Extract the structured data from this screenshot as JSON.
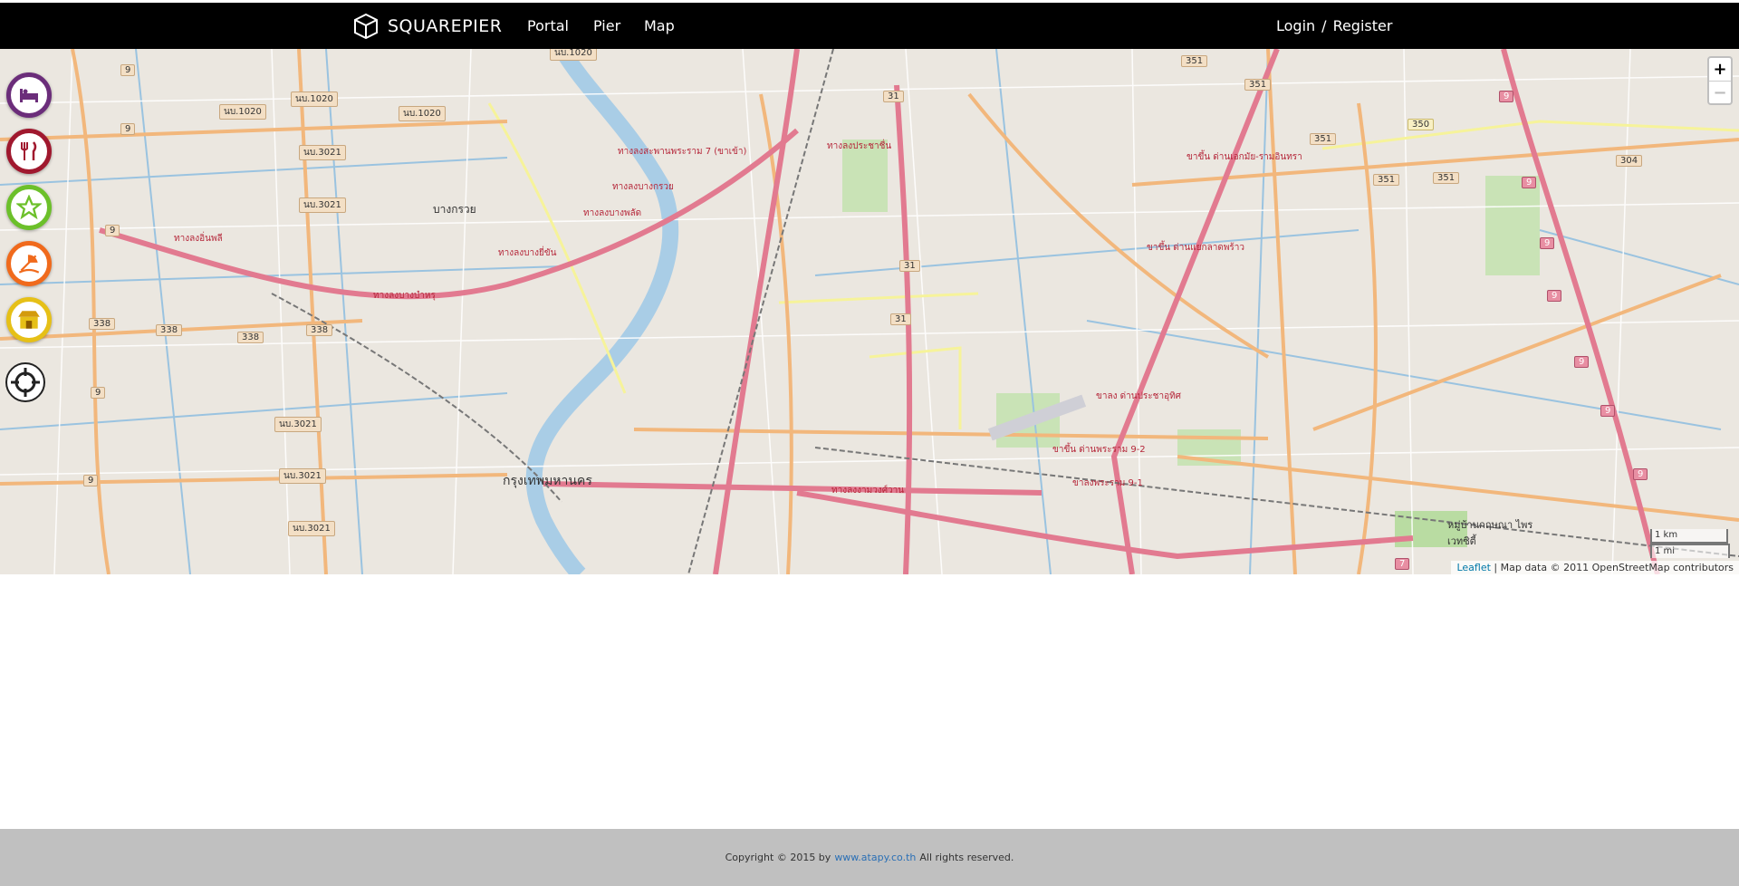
{
  "navbar": {
    "brand": "SQUAREPIER",
    "links": [
      "Portal",
      "Pier",
      "Map"
    ],
    "login": "Login",
    "separator": "/",
    "register": "Register"
  },
  "map": {
    "zoom_in": "+",
    "zoom_out": "−",
    "scale_km": "1 km",
    "scale_mi": "1 mi",
    "attribution": {
      "leaflet": "Leaflet",
      "rest": "| Map data © 2011 OpenStreetMap contributors"
    },
    "categories": [
      {
        "icon": "bed-icon",
        "color": "#6b2d7a"
      },
      {
        "icon": "fork-knife-icon",
        "color": "#a0182e"
      },
      {
        "icon": "star-icon",
        "color": "#6cc02a"
      },
      {
        "icon": "beach-icon",
        "color": "#f06a1c"
      },
      {
        "icon": "store-icon",
        "color": "#e6c017"
      }
    ],
    "labels": [
      "ทางลงสะพานพระราม 7 (ขาเข้า)",
      "ทางลงบางกรวย",
      "ทางลงบางพลัด",
      "ทางลงบางยี่ขัน",
      "ทางลงอิ่นพลี",
      "ทางลงบางบำหรุ",
      "ทางลงประชาชื่น",
      "ทางลงงามวงศ์วาน",
      "ขาขึ้น ด่านแยกลาดพร้าว",
      "ขาขึ้น ด่านพระราม 9-2",
      "ขาลง ด่านประชาอุทิศ",
      "ขาลงพระราม 9-1",
      "บางกรวย",
      "กรุงเทพมหานคร",
      "หมู่บ้านกฤษณา ไพรเวทซิตี้",
      "ขาขึ้น ด่านเอกมัย-รามอินทรา"
    ],
    "shields": [
      "9",
      "นบ.1020",
      "นบ.3021",
      "338",
      "31",
      "351",
      "350",
      "304",
      "7"
    ]
  },
  "footer": {
    "prefix": "Copyright © 2015 by",
    "link": "www.atapy.co.th",
    "suffix": "All rights reserved."
  }
}
